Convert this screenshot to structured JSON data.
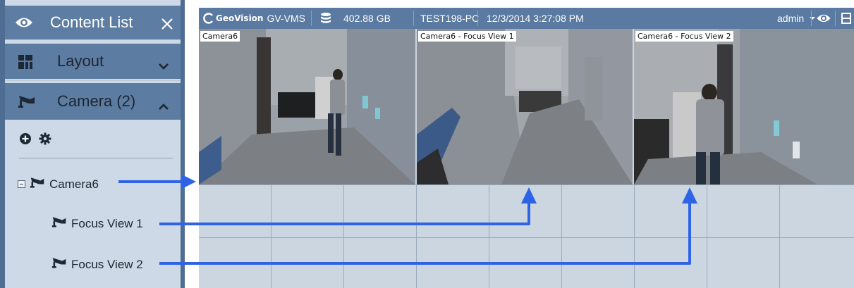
{
  "panel": {
    "title": "Content List",
    "title_icon": "eye-icon",
    "close_icon": "close-icon",
    "layout_label": "Layout",
    "layout_icon": "layout-grid-icon",
    "camera_label": "Camera (2)",
    "camera_icon": "camera-icon",
    "tree": {
      "camera6": "Camera6",
      "focus_view_1": "Focus View 1",
      "focus_view_2": "Focus View 2"
    }
  },
  "topbar": {
    "brand": "GeoVision",
    "product": "GV-VMS",
    "storage": "402.88 GB",
    "pc_name": "TEST198-PC",
    "datetime": "12/3/2014 3:27:08 PM",
    "user": "admin"
  },
  "tiles": [
    {
      "label": "Camera6"
    },
    {
      "label": "Camera6 - Focus View 1"
    },
    {
      "label": "Camera6 - Focus View 2"
    }
  ],
  "colors": {
    "arrow": "#2f63e6",
    "panel_header": "#5d7ca2",
    "panel_body": "#cdd9e6",
    "topbar": "#5a7aa1"
  }
}
